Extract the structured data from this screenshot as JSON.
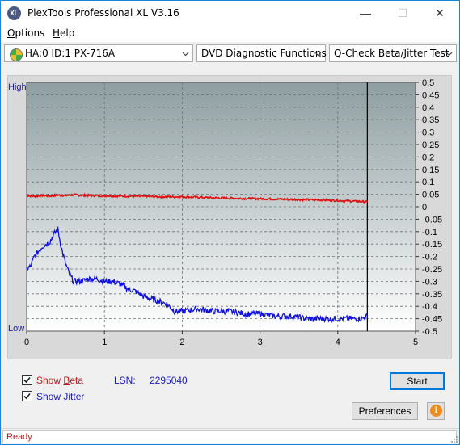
{
  "window": {
    "title": "PlexTools Professional XL V3.16",
    "app_icon": "XL",
    "minimize_icon": "—",
    "maximize_icon": "☐",
    "close_icon": "✕"
  },
  "menu": {
    "items": [
      {
        "label": "Options",
        "mnemonic": "O",
        "rest": "ptions"
      },
      {
        "label": "Help",
        "mnemonic": "H",
        "rest": "elp"
      }
    ]
  },
  "toolbar": {
    "drive": "HA:0 ID:1  PX-716A",
    "function": "DVD Diagnostic Functions",
    "test": "Q-Check Beta/Jitter Test"
  },
  "chart": {
    "high_label": "High",
    "low_label": "Low",
    "colors": {
      "beta": "#e01010",
      "jitter": "#1010e0",
      "background_top": "#8e9ea1",
      "background_bottom": "#ffffff",
      "gridline": "#707070"
    }
  },
  "chart_data": {
    "type": "line",
    "xlim": [
      0,
      5
    ],
    "x_ticks": [
      "0",
      "1",
      "2",
      "3",
      "4",
      "5"
    ],
    "ylim_right": [
      -0.5,
      0.5
    ],
    "y_ticks_right": [
      "0.5",
      "0.45",
      "0.4",
      "0.35",
      "0.3",
      "0.25",
      "0.2",
      "0.15",
      "0.1",
      "0.05",
      "0",
      "-0.05",
      "-0.1",
      "-0.15",
      "-0.2",
      "-0.25",
      "-0.3",
      "-0.35",
      "-0.4",
      "-0.45",
      "-0.5"
    ],
    "end_marker_x": 4.38,
    "grid": true,
    "series": [
      {
        "name": "Beta",
        "x": [
          0.0,
          0.1,
          0.2,
          0.3,
          0.4,
          0.5,
          0.6,
          0.7,
          0.8,
          1.0,
          1.2,
          1.4,
          1.6,
          1.8,
          2.0,
          2.2,
          2.5,
          2.8,
          3.0,
          3.3,
          3.6,
          3.8,
          4.0,
          4.2,
          4.38
        ],
        "y": [
          0.045,
          0.042,
          0.045,
          0.043,
          0.047,
          0.045,
          0.048,
          0.046,
          0.045,
          0.044,
          0.043,
          0.042,
          0.041,
          0.04,
          0.04,
          0.038,
          0.035,
          0.033,
          0.032,
          0.03,
          0.028,
          0.027,
          0.025,
          0.022,
          0.02
        ]
      },
      {
        "name": "Jitter",
        "x": [
          0.0,
          0.05,
          0.1,
          0.15,
          0.2,
          0.25,
          0.3,
          0.35,
          0.4,
          0.45,
          0.5,
          0.55,
          0.6,
          0.7,
          0.8,
          0.9,
          1.0,
          1.1,
          1.2,
          1.3,
          1.4,
          1.5,
          1.6,
          1.7,
          1.8,
          1.9,
          2.0,
          2.2,
          2.4,
          2.6,
          2.8,
          3.0,
          3.2,
          3.4,
          3.6,
          3.7,
          3.9,
          4.1,
          4.3,
          4.38
        ],
        "y": [
          -0.25,
          -0.24,
          -0.2,
          -0.18,
          -0.16,
          -0.15,
          -0.14,
          -0.11,
          -0.09,
          -0.17,
          -0.23,
          -0.27,
          -0.3,
          -0.3,
          -0.29,
          -0.29,
          -0.3,
          -0.3,
          -0.31,
          -0.33,
          -0.34,
          -0.36,
          -0.37,
          -0.38,
          -0.39,
          -0.42,
          -0.42,
          -0.41,
          -0.42,
          -0.42,
          -0.43,
          -0.43,
          -0.44,
          -0.44,
          -0.45,
          -0.45,
          -0.45,
          -0.45,
          -0.45,
          -0.44
        ]
      }
    ]
  },
  "controls": {
    "show_beta": "Show Beta",
    "show_beta_prefix": "Show ",
    "show_beta_mnemonic": "B",
    "show_beta_rest": "eta",
    "show_jitter": "Show Jitter",
    "show_jitter_prefix": "Show ",
    "show_jitter_mnemonic": "J",
    "show_jitter_rest": "itter",
    "show_beta_checked": true,
    "show_jitter_checked": true,
    "lsn_label": "LSN:",
    "lsn_value": "2295040",
    "start_label": "Start",
    "preferences_label": "Preferences",
    "info_icon": "i"
  },
  "status": {
    "text": "Ready"
  }
}
